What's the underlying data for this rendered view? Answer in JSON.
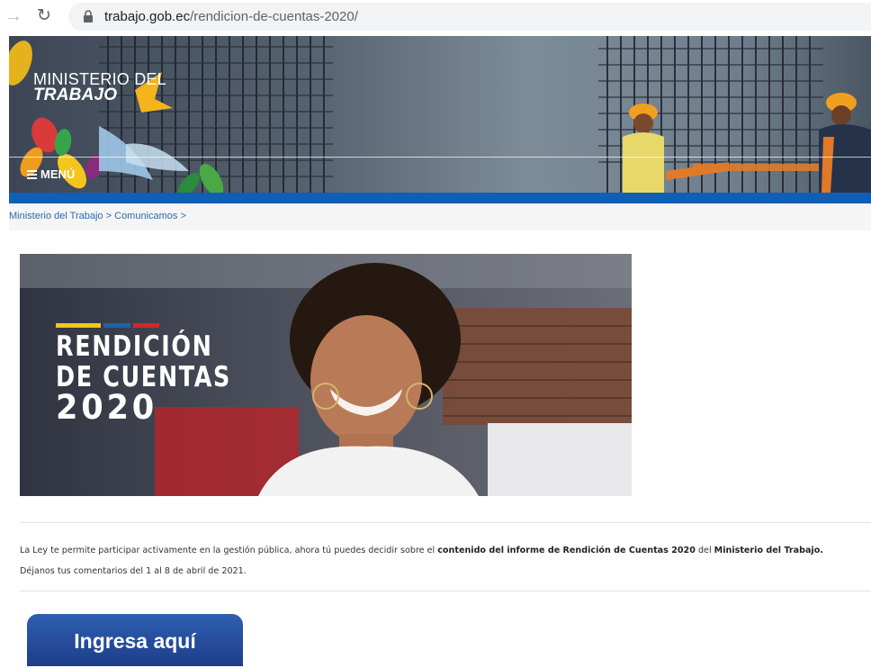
{
  "browser": {
    "url_domain": "trabajo.gob.ec",
    "url_path": "/rendicion-de-cuentas-2020/"
  },
  "header": {
    "logo_line1": "MINISTERIO DEL",
    "logo_line2": "TRABAJO",
    "menu_label": "MENÚ"
  },
  "breadcrumb": {
    "items": [
      "Ministerio del Trabajo",
      "Comunicamos"
    ],
    "separator": ">"
  },
  "banner": {
    "line1": "RENDICIÓN",
    "line2": "DE CUENTAS",
    "line3": "2020",
    "flag_colors": [
      "#f4c51c",
      "#1f5fb0",
      "#d3262c"
    ]
  },
  "content": {
    "intro_part1": "La Ley te permite participar activamente en la gestión pública, ahora tú puedes decidir sobre el ",
    "intro_bold1": "contenido del informe de Rendición de Cuentas 2020",
    "intro_part2": " del ",
    "intro_bold2": "Ministerio del Trabajo.",
    "intro_line2": "Déjanos tus comentarios del 1 al 8 de abril de 2021.",
    "cta_label": "Ingresa aquí"
  },
  "colors": {
    "brand_blue": "#0f5fb5",
    "cta_blue": "#1d3d8a",
    "link_blue": "#2b6cb0"
  }
}
